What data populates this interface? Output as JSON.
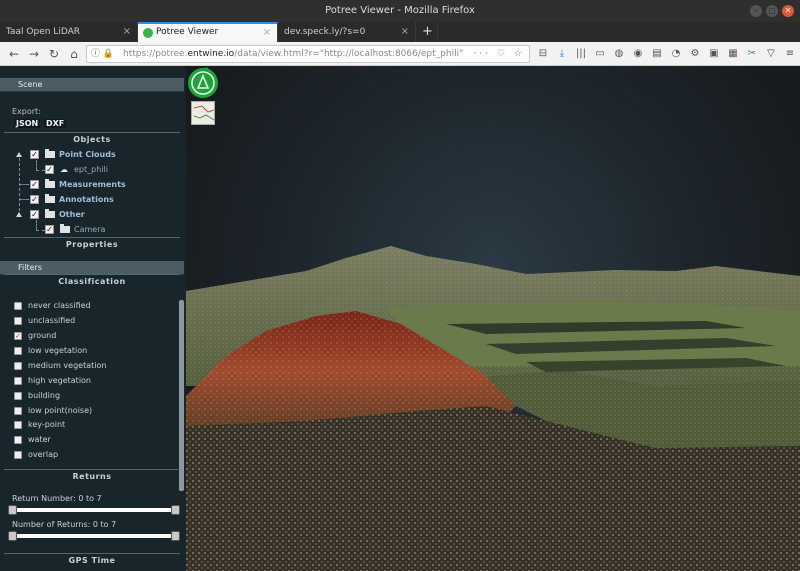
{
  "window": {
    "title": "Potree Viewer - Mozilla Firefox",
    "controls": [
      "–",
      "▢",
      "✕"
    ]
  },
  "tabs": [
    {
      "label": "Taal Open LiDAR",
      "active": false
    },
    {
      "label": "Potree Viewer",
      "active": true
    },
    {
      "label": "dev.speck.ly/?s=0",
      "active": false
    }
  ],
  "newtab_label": "+",
  "navbar": {
    "url_prefix": "https://potree.",
    "url_domain": "entwine.io",
    "url_suffix": "/data/view.html?r=\"http://localhost:8066/ept_phili\"",
    "url_right_icons": "··· ♡ ☆",
    "icons": [
      "back-icon",
      "forward-icon",
      "reload-icon",
      "home-icon",
      "library-icon",
      "download-icon",
      "sidebar-icon",
      "reader-icon",
      "pocket-icon",
      "sync-icon",
      "account-icon",
      "screenshot-icon",
      "extension-icon",
      "overflow-icon",
      "menu-icon"
    ]
  },
  "sidebar": {
    "scene_label": "Scene",
    "export_label": "Export:",
    "export_buttons": [
      "JSON",
      "DXF"
    ],
    "objects_title": "Objects",
    "tree": {
      "point_clouds": "Point Clouds",
      "ept": "ept_phili",
      "measurements": "Measurements",
      "annotations": "Annotations",
      "other": "Other",
      "camera": "Camera"
    },
    "properties_title": "Properties",
    "filters_label": "Filters",
    "classification_title": "Classification",
    "classes": [
      {
        "label": "never classified",
        "checked": false
      },
      {
        "label": "unclassified",
        "checked": false
      },
      {
        "label": "ground",
        "checked": true
      },
      {
        "label": "low vegetation",
        "checked": false
      },
      {
        "label": "medium vegetation",
        "checked": false
      },
      {
        "label": "high vegetation",
        "checked": false
      },
      {
        "label": "building",
        "checked": false
      },
      {
        "label": "low point(noise)",
        "checked": false
      },
      {
        "label": "key-point",
        "checked": false
      },
      {
        "label": "water",
        "checked": false
      },
      {
        "label": "overlap",
        "checked": false
      }
    ],
    "returns_title": "Returns",
    "return_number_label": "Return Number: 0 to 7",
    "number_of_returns_label": "Number of Returns: 0 to 7",
    "gps_title": "GPS Time"
  },
  "colors": {
    "sidebar_bg": "#18252b",
    "accordion_bg": "#4b5c64",
    "tree_label": "#9fbcd9",
    "brand_green": "#1ea33a"
  }
}
